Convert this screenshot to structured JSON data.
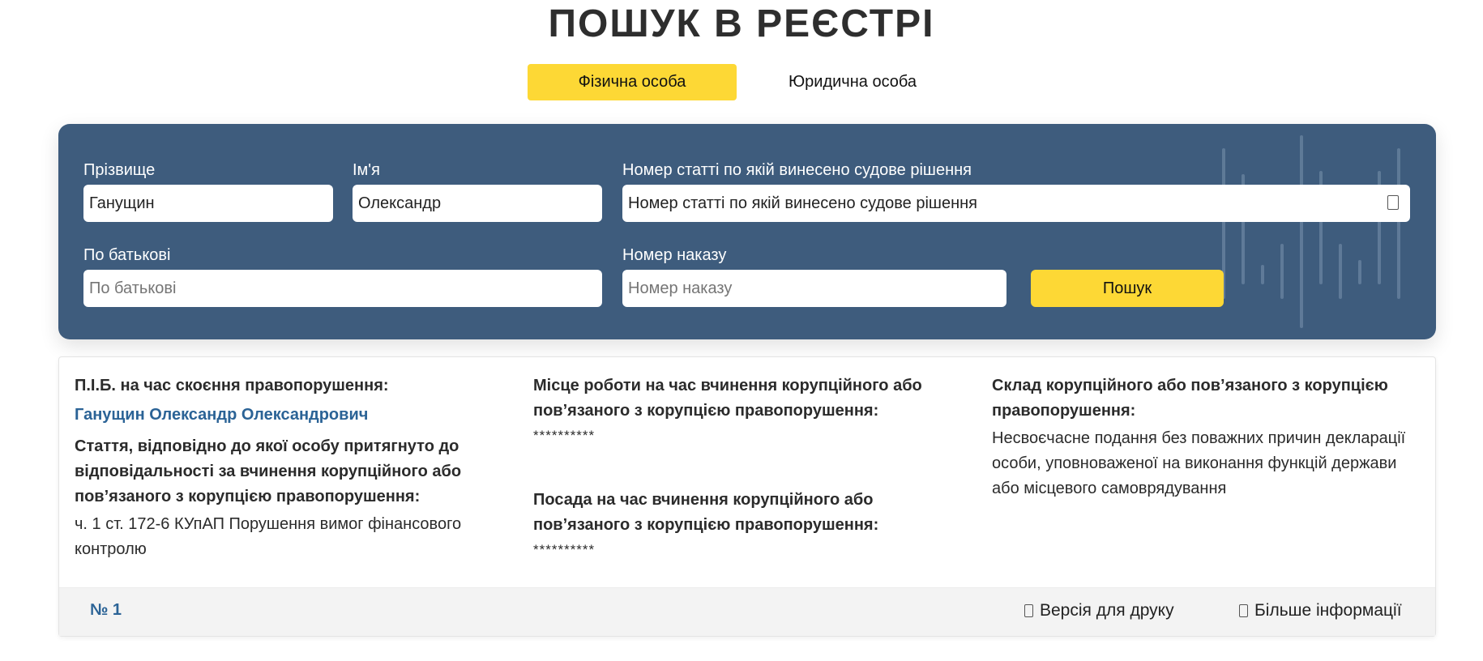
{
  "page": {
    "title": "ПОШУК В РЕЄСТРІ"
  },
  "tabs": [
    {
      "label": "Фізична особа",
      "active": true
    },
    {
      "label": "Юридична особа",
      "active": false
    }
  ],
  "search": {
    "surname": {
      "label": "Прізвище",
      "value": "Ганущин",
      "placeholder": "Прізвище"
    },
    "name": {
      "label": "Ім'я",
      "value": "Олександр",
      "placeholder": "Ім'я"
    },
    "article": {
      "label": "Номер статті по якій винесено судове рішення",
      "value": "Номер статті по якій винесено судове рішення",
      "icon": "chevron-down-icon"
    },
    "patronymic": {
      "label": "По батькові",
      "value": "",
      "placeholder": "По батькові"
    },
    "order_number": {
      "label": "Номер наказу",
      "value": "",
      "placeholder": "Номер наказу"
    },
    "submit_label": "Пошук"
  },
  "result": {
    "name_label": "П.І.Б. на час скоєння правопорушення:",
    "name_value": "Ганущин Олександр Олександрович",
    "article_label": "Стаття, відповідно до якої особу притягнуто до відповідальності за вчинення корупційного або пов’язаного з корупцією правопорушення:",
    "article_value": "ч. 1 ст. 172-6 КУпАП Порушення вимог фінансового контролю",
    "workplace_label": "Місце роботи на час вчинення корупційного або пов’язаного з корупцією правопорушення:",
    "workplace_value": "**********",
    "position_label": "Посада на час вчинення корупційного або пов’язаного з корупцією правопорушення:",
    "position_value": "**********",
    "composition_label": "Склад корупційного або пов’язаного з корупцією правопорушення:",
    "composition_value": "Несвоєчасне подання без поважних причин декларації особи, уповноваженої на виконання функцій держави або місцевого самоврядування",
    "record_number": "№ 1",
    "print_label": "Версія для друку",
    "more_label": "Більше інформації"
  },
  "colors": {
    "accent_yellow": "#fdd835",
    "panel_blue": "#3e5c7d",
    "link_blue": "#2b6396"
  }
}
